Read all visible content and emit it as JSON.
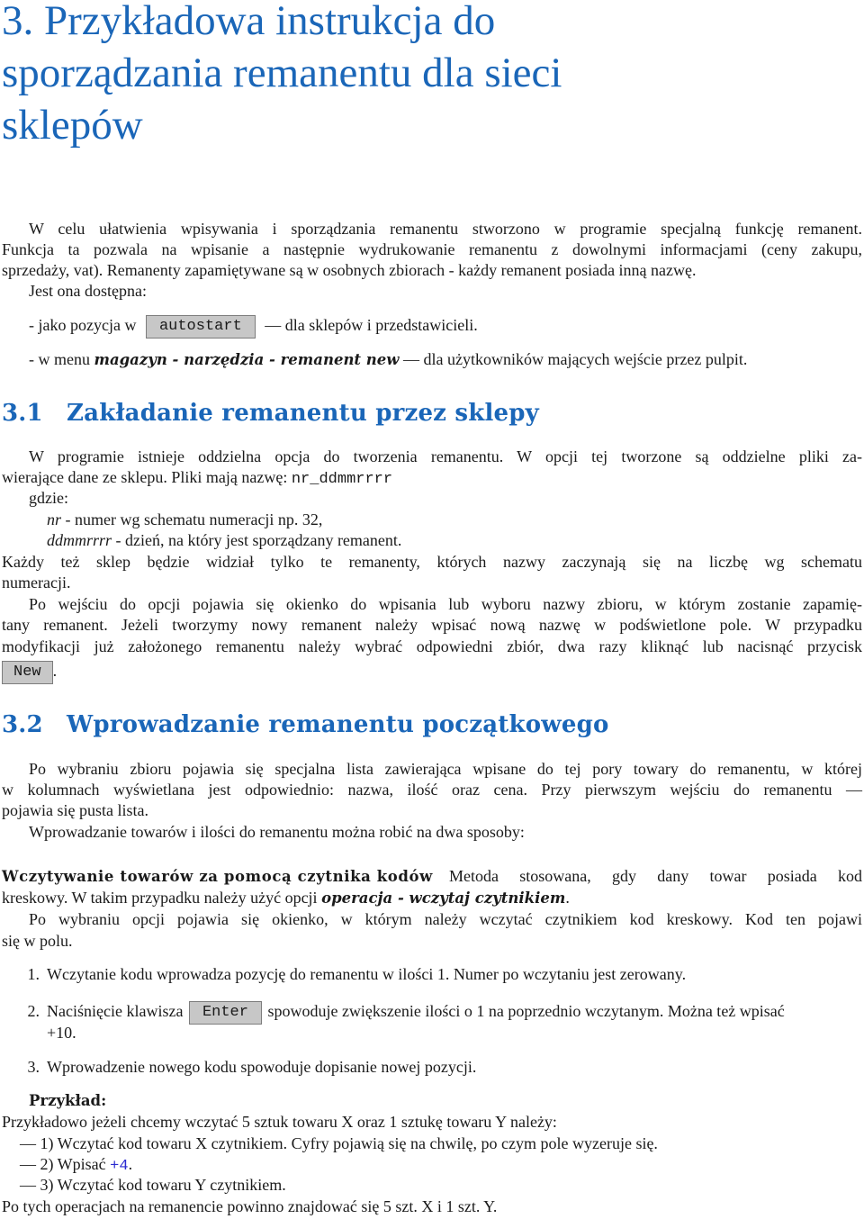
{
  "title": {
    "lines": [
      "3.  Przykładowa instrukcja do",
      "sporządzania remanentu dla sieci",
      "sklepów"
    ]
  },
  "intro": {
    "lines": [
      "W celu ułatwienia wpisywania i sporządzania remanentu stworzono w programie specjalną funkcję remanent.",
      "Funkcja ta pozwala na wpisanie a następnie wydrukowanie remanentu z dowolnymi informacjami (ceny zakupu,",
      "sprzedaży, vat). Remanenty zapamiętywane są w osobnych zbiorach - każdy remanent posiada inną nazwę.",
      "Jest ona dostępna:"
    ],
    "access1": {
      "prefix": "- jako pozycja w",
      "button": "autostart",
      "suffix": "— dla sklepów i przedstawicieli."
    },
    "access2": {
      "prefix": "- w menu",
      "menu_path": "magazyn - narzędzia - remanent new",
      "suffix": "— dla użytkowników mających wejście przez pulpit."
    }
  },
  "section31": {
    "number": "3.1",
    "heading": "Zakładanie remanentu przez sklepy",
    "line1": "W programie istnieje oddzielna opcja do tworzenia remanentu. W opcji tej tworzone są oddzielne pliki za-",
    "line2_text": "wierające dane ze sklepu. Pliki mają nazwę: ",
    "filename": "nr_ddmmrrrr",
    "where": "gdzie:",
    "def1_term": "nr",
    "def1_text": " - numer wg schematu numeracji np. 32,",
    "def2_term": "ddmmrrrr",
    "def2_text": " - dzień, na który jest sporządzany remanent.",
    "line_each1": "Każdy też sklep będzie widział tylko te remanenty, których nazwy zaczynają się na liczbę wg schematu",
    "line_each2": "numeracji.",
    "p2_line1": "Po wejściu do opcji pojawia się okienko do wpisania lub wyboru nazwy zbioru, w którym zostanie zapamię-",
    "p2_line2": "tany remanent. Jeżeli tworzymy nowy remanent należy wpisać nową nazwę w podświetlone pole. W przypadku",
    "p2_line3": "modyfikacji już założonego remanentu należy wybrać odpowiedni zbiór, dwa razy kliknąć lub nacisnąć przycisk",
    "new_button": "New",
    "period": "."
  },
  "section32": {
    "number": "3.2",
    "heading": "Wprowadzanie remanentu początkowego",
    "p1_line1": "Po wybraniu zbioru pojawia się specjalna lista zawierająca wpisane do tej pory towary do remanentu, w której",
    "p1_line2": "w kolumnach wyświetlana jest odpowiednio: nazwa, ilość oraz cena. Przy pierwszym wejściu do remanentu —",
    "p1_line3": "pojawia się pusta lista.",
    "p2": "Wprowadzanie towarów i ilości do remanentu można robić na dwa sposoby:",
    "method_term": "Wczytywanie towarów za pomocą czytnika kodów",
    "method_line1": "Metoda stosowana, gdy dany towar posiada kod",
    "method_line2_a": "kreskowy. W takim przypadku należy użyć opcji ",
    "method_line2_b": "operacja - wczytaj czytnikiem",
    "method_line2_c": ".",
    "p3_line1": "Po wybraniu opcji pojawia się okienko, w którym należy wczytać czytnikiem kod kreskowy. Kod ten pojawi",
    "p3_line2": "się w polu.",
    "list": [
      {
        "num": "1.",
        "text": "Wczytanie kodu wprowadza pozycję do remanentu w ilości 1. Numer po wczytaniu jest zerowany."
      },
      {
        "num": "2.",
        "text_a": "Naciśnięcie klawisza",
        "button": "Enter",
        "text_b": "spowoduje zwiększenie ilości o 1 na poprzednio wczytanym. Można też wpisać",
        "text_c": "+10."
      },
      {
        "num": "3.",
        "text": "Wprowadzenie nowego kodu spowoduje dopisanie nowej pozycji."
      }
    ],
    "example": {
      "label": "Przykład:",
      "intro": "Przykładowo jeżeli chcemy wczytać 5 sztuk towaru X oraz 1 sztukę towaru Y należy:",
      "step1": "— 1) Wczytać kod towaru X czytnikiem. Cyfry pojawią się na chwilę, po czym pole wyzeruje się.",
      "step2_a": "— 2) Wpisać ",
      "step2_code": "+4",
      "step2_b": ".",
      "step3": "— 3) Wczytać kod towaru Y czytnikiem.",
      "result": "Po tych operacjach na remanencie powinno znajdować się 5 szt. X i 1 szt. Y."
    }
  }
}
